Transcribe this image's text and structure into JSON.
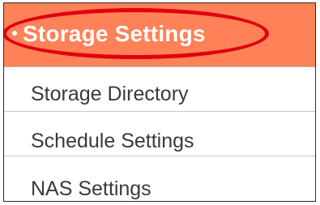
{
  "menu": {
    "header": {
      "label": "Storage Settings",
      "accent_color": "#ff8157",
      "highlight_color": "#e00010",
      "bullet_icon": "bullet-icon"
    },
    "items": [
      {
        "label": "Storage Directory"
      },
      {
        "label": "Schedule Settings"
      },
      {
        "label": "NAS Settings"
      }
    ]
  }
}
